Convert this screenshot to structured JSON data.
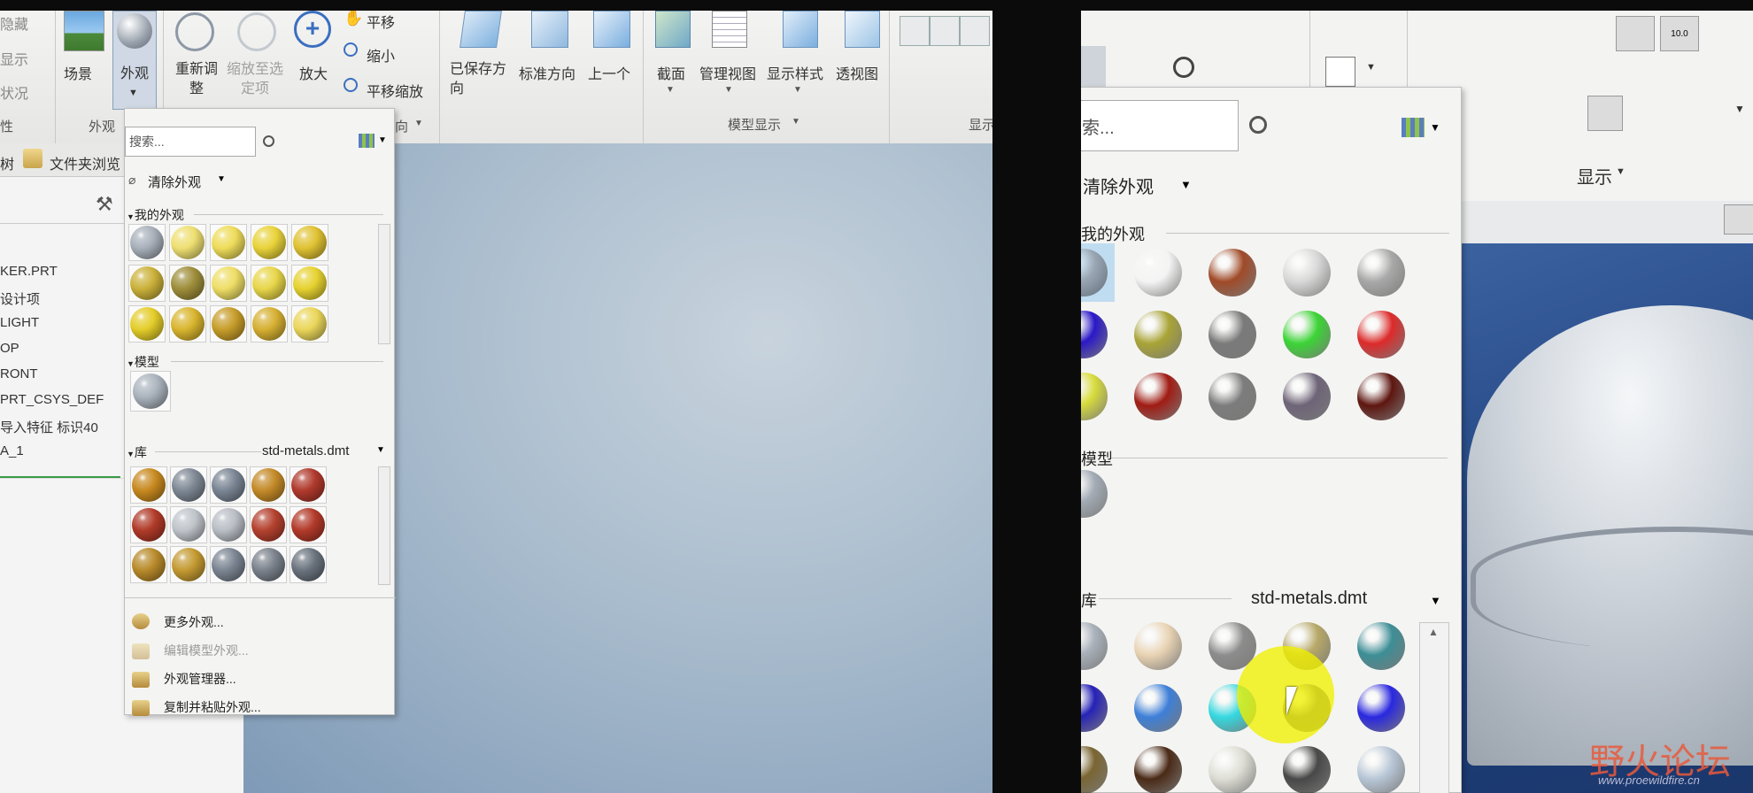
{
  "left_app": {
    "ribbon": {
      "items_col1": [
        "隐藏",
        "显示",
        "状况"
      ],
      "col1_group": "性",
      "scene_label": "场景",
      "appearance_label": "外观",
      "appearance_group": "外观",
      "regen_label": "重新调整",
      "zoom_fit_label": "缩放至选定项",
      "zoom_in_label": "放大",
      "pan_label": "平移",
      "zoom_out_label": "缩小",
      "pan_zoom_label": "平移缩放",
      "direction_group": "向",
      "saved_view_label": "已保存方向",
      "std_dir_label": "标准方向",
      "prev_label": "上一个",
      "section_label": "截面",
      "manage_view_label": "管理视图",
      "display_style_label": "显示样式",
      "perspective_label": "透视图",
      "model_display_group": "模型显示",
      "display_group": "显示"
    },
    "tree": {
      "tab1": "树",
      "tab2": "文件夹浏览",
      "items": [
        "KER.PRT",
        "设计项",
        "LIGHT",
        "OP",
        "RONT",
        "PRT_CSYS_DEF",
        "导入特征 标识40",
        "A_1"
      ]
    },
    "popup": {
      "search_placeholder": "搜索...",
      "clear_label": "清除外观",
      "my_appearances": "我的外观",
      "model": "模型",
      "library": "库",
      "library_file": "std-metals.dmt",
      "menu": {
        "more": "更多外观...",
        "edit_model": "编辑模型外观...",
        "manager": "外观管理器...",
        "copy_paste": "复制并粘贴外观..."
      },
      "my_colors": [
        "#a8b0ba",
        "#eedf72",
        "#eedc5a",
        "#e9d33a",
        "#e0c232",
        "#cbb13a",
        "#9e8e3a",
        "#eede66",
        "#e8d649",
        "#e6d230",
        "#e4cd2a",
        "#d9b52e",
        "#c79d2a",
        "#d6b032",
        "#ead65a"
      ],
      "model_colors": [
        "#aab3bd"
      ],
      "lib_colors": [
        "#c7891f",
        "#7e8894",
        "#7a8594",
        "#c48a28",
        "#b0392c",
        "#b03a28",
        "#bfc4ca",
        "#b9bec5",
        "#b4412f",
        "#b23a2a",
        "#b88a2a",
        "#c49a32",
        "#7b8592",
        "#7b828c",
        "#6a737e"
      ]
    }
  },
  "right_app": {
    "search_placeholder": "索...",
    "clear_label": "清除外观",
    "my_appearances": "我的外观",
    "model": "模型",
    "library": "库",
    "library_file": "std-metals.dmt",
    "display_group": "显示",
    "my_colors": [
      "#9aa6b4",
      "#f4f4f4",
      "#a04a28",
      "#d8d8d8",
      "#a8a8a8",
      "#2a18c8",
      "#a9a436",
      "#7a7a7a",
      "#3cd436",
      "#dd2a2a",
      "#d8dc3c",
      "#a01c14",
      "#7c7c7c",
      "#6e6478",
      "#5e1610"
    ],
    "model_colors": [
      "#a3abb5"
    ],
    "lib_colors": [
      "#a9b1bb",
      "#e9d3b3",
      "#8c8c8c",
      "#b7a867",
      "#3d8e96",
      "#2622b8",
      "#3e7fd8",
      "#35d8e0",
      "#6a6a86",
      "#2a28e0",
      "#7a6532",
      "#4a2a16",
      "#ddddd4",
      "#484848",
      "#b7c6d6"
    ]
  },
  "watermark": {
    "title": "野火论坛",
    "url": "www.proewildfire.cn"
  }
}
